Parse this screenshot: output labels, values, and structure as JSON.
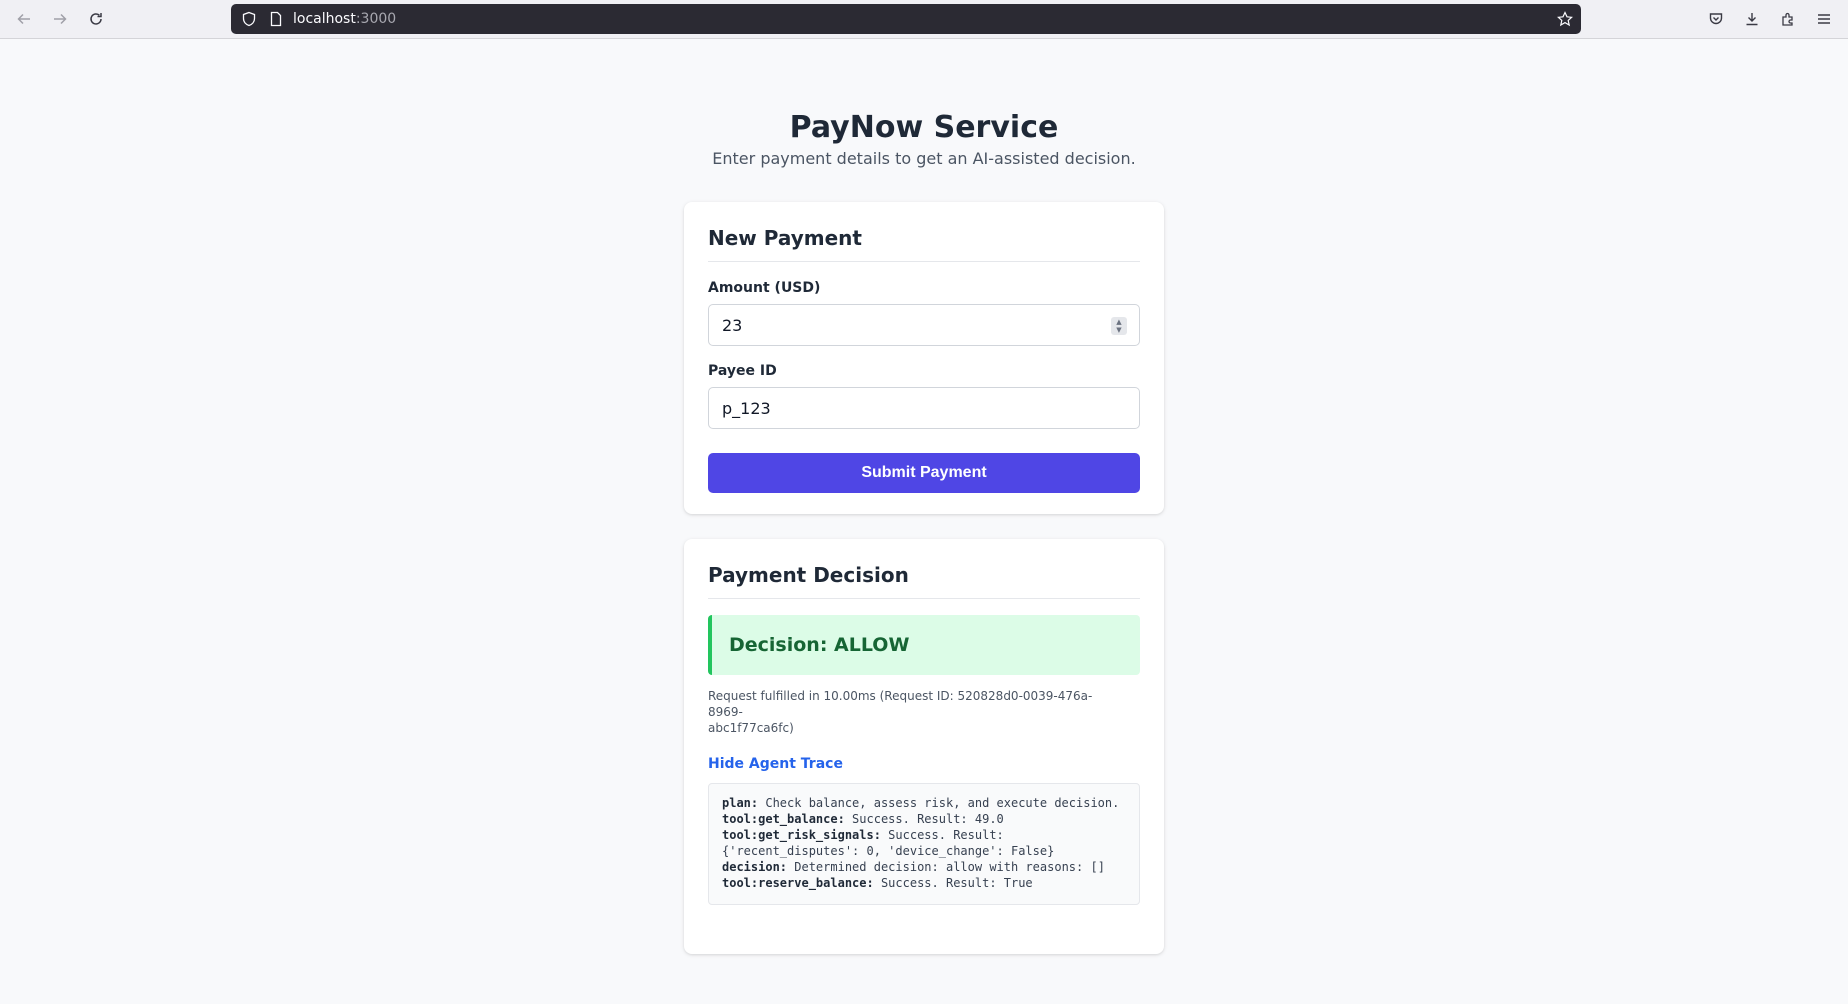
{
  "browser": {
    "url_host": "localhost",
    "url_port": ":3000"
  },
  "header": {
    "title": "PayNow Service",
    "subtitle": "Enter payment details to get an AI-assisted decision."
  },
  "form": {
    "title": "New Payment",
    "amount_label": "Amount (USD)",
    "amount_value": "23",
    "payee_label": "Payee ID",
    "payee_value": "p_123",
    "submit_label": "Submit Payment"
  },
  "result": {
    "title": "Payment Decision",
    "decision": "Decision: ALLOW",
    "meta_line1": "Request fulfilled in 10.00ms (Request ID: 520828d0-0039-476a-8969-",
    "meta_line2": "abc1f77ca6fc)",
    "trace_toggle": "Hide Agent Trace",
    "trace": [
      {
        "key": "plan:",
        "text": " Check balance, assess risk, and execute decision."
      },
      {
        "key": "tool:get_balance:",
        "text": " Success. Result: 49.0"
      },
      {
        "key": "tool:get_risk_signals:",
        "text": " Success. Result:"
      },
      {
        "key": "",
        "text": "{'recent_disputes': 0, 'device_change': False}"
      },
      {
        "key": "decision:",
        "text": " Determined decision: allow with reasons: []"
      },
      {
        "key": "tool:reserve_balance:",
        "text": " Success. Result: True"
      }
    ]
  },
  "colors": {
    "accent": "#4f46e5",
    "success_bg": "#dcfce7",
    "success_border": "#22c55e",
    "success_text": "#166534",
    "link": "#2563eb"
  }
}
